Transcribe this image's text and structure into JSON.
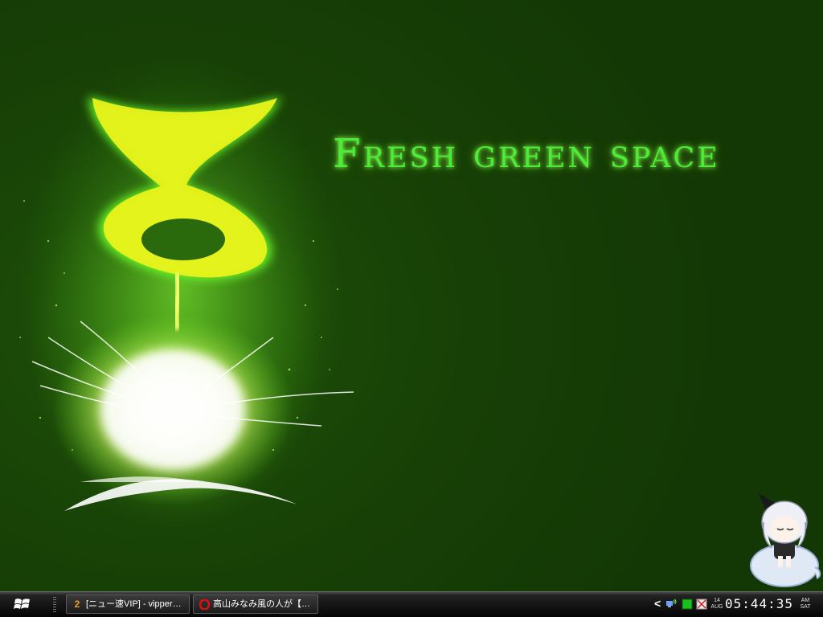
{
  "wallpaper": {
    "title": "Fresh green space"
  },
  "taskbar": {
    "start_icon": "windows-logo-icon",
    "tasks": [
      {
        "label": "[ニュー速VIP] - vipper…",
        "icon": "2ch-browser-icon",
        "icon_glyph": "2"
      },
      {
        "label": "高山みなみ風の人が【…",
        "icon": "opera-icon",
        "icon_glyph": "O"
      }
    ]
  },
  "tray": {
    "chevron": "<",
    "icons": [
      "network-icon",
      "green-square-icon",
      "disabled-icon"
    ],
    "date_day": "14",
    "date_month": "AUG",
    "time": "05:44:35",
    "ampm": "AM",
    "weekday": "SAT"
  },
  "colors": {
    "title": "#4aee38",
    "background": "#163d05",
    "taskbar": "#151515"
  }
}
